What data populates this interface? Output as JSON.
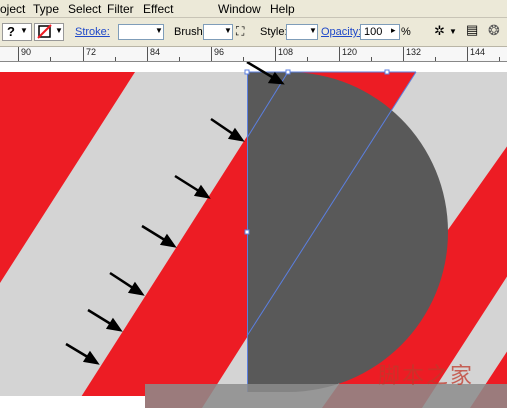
{
  "menu": {
    "items": [
      "oject",
      "Type",
      "Select",
      "Filter",
      "Effect",
      "Window",
      "Help"
    ]
  },
  "toolbar": {
    "stroke_label": "Stroke:",
    "brush_label": "Brush:",
    "style_label": "Style:",
    "opacity_label": "Opacity:",
    "opacity_value": "100",
    "percent": "%",
    "help_glyph": "?"
  },
  "ruler": {
    "labels": [
      "90",
      "72",
      "84",
      "96",
      "108",
      "120",
      "132",
      "144"
    ]
  },
  "watermark": "脚本之家",
  "colors": {
    "red": "#ed1c24",
    "grey": "#d4d4d4",
    "dark": "#595959",
    "guide": "#5b7fe0"
  }
}
